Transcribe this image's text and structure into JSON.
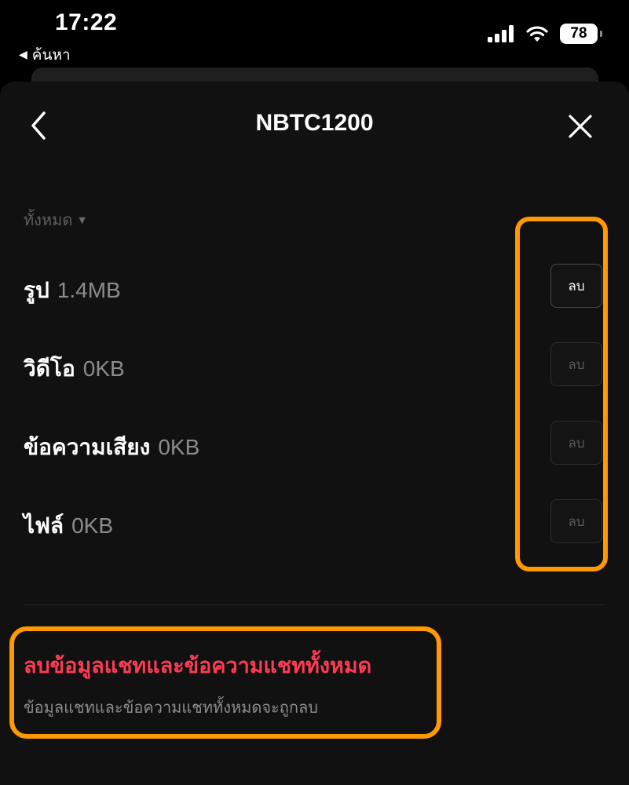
{
  "status_bar": {
    "time": "17:22",
    "back_app_label": "ค้นหา",
    "battery_level": "78"
  },
  "header": {
    "title": "NBTC1200",
    "back_icon": "chevron-left-icon",
    "close_icon": "close-icon"
  },
  "filter": {
    "label": "ทั้งหมด"
  },
  "storage_rows": [
    {
      "name": "รูป",
      "size": "1.4MB",
      "button_label": "ลบ",
      "enabled": true
    },
    {
      "name": "วิดีโอ",
      "size": "0KB",
      "button_label": "ลบ",
      "enabled": false
    },
    {
      "name": "ข้อความเสียง",
      "size": "0KB",
      "button_label": "ลบ",
      "enabled": false
    },
    {
      "name": "ไฟล์",
      "size": "0KB",
      "button_label": "ลบ",
      "enabled": false
    }
  ],
  "delete_all": {
    "title": "ลบข้อมูลแชทและข้อความแชททั้งหมด",
    "subtitle": "ข้อมูลแชทและข้อความแชททั้งหมดจะถูกลบ"
  },
  "colors": {
    "background": "#111111",
    "danger": "#ff3b54",
    "highlight": "#ff9900"
  }
}
